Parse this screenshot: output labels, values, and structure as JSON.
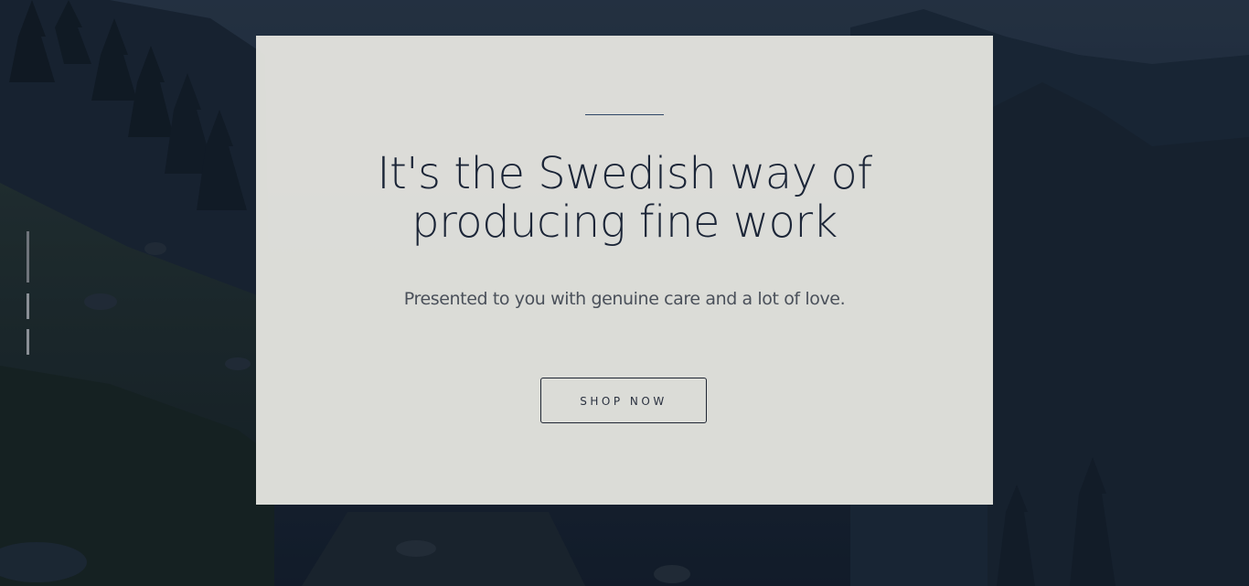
{
  "hero": {
    "headline_line1": "It's the Swedish way of",
    "headline_line2": "producing fine work",
    "subtitle": "Presented to you with genuine care and a lot of love.",
    "cta_label": "SHOP NOW",
    "background_description_icon": "mountain-landscape-image",
    "slide_count": 3,
    "active_slide": 1
  },
  "colors": {
    "overlay": "#15202f",
    "card": "#e2e2dd",
    "headline": "#1b2537",
    "accent_rule": "#2f4767"
  }
}
